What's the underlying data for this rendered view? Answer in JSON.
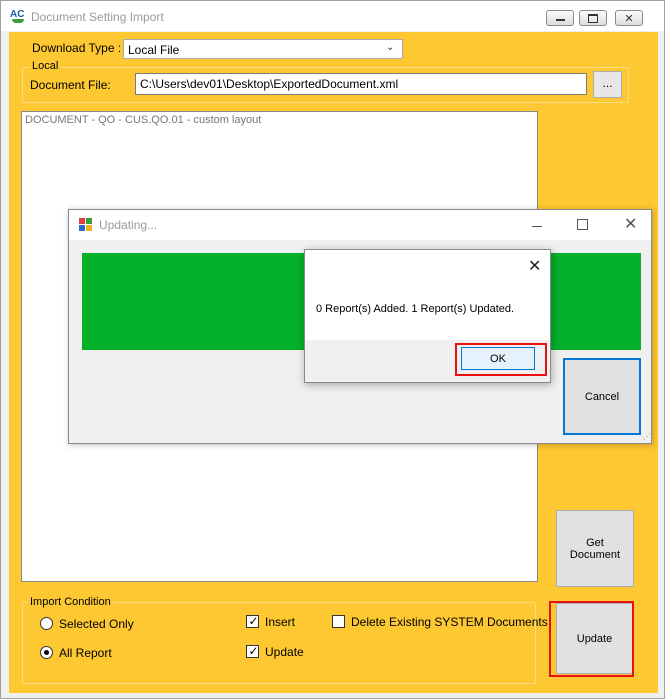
{
  "app": {
    "title": "Document Setting Import",
    "icon_text": "AC"
  },
  "download": {
    "label": "Download Type :",
    "value": "Local File"
  },
  "local": {
    "legend": "Local",
    "file_label": "Document File:",
    "file_value": "C:\\Users\\dev01\\Desktop\\ExportedDocument.xml",
    "browse_label": "..."
  },
  "doc_list": {
    "items": [
      "DOCUMENT - QO - CUS.QO.01 - custom layout"
    ]
  },
  "buttons": {
    "get_document": "Get Document",
    "update": "Update"
  },
  "import_condition": {
    "legend": "Import Condition",
    "radios": [
      {
        "label": "Selected Only",
        "checked": false
      },
      {
        "label": "All Report",
        "checked": true
      }
    ],
    "checkboxes": [
      {
        "label": "Insert",
        "checked": true
      },
      {
        "label": "Update",
        "checked": true
      },
      {
        "label": "Delete Existing SYSTEM Documents",
        "checked": false
      }
    ]
  },
  "updating_dialog": {
    "title": "Updating...",
    "progress": 1.0,
    "cancel_label": "Cancel"
  },
  "message_box": {
    "text": "0 Report(s) Added. 1 Report(s) Updated.",
    "ok_label": "OK"
  },
  "colors": {
    "form_background": "#fdc832",
    "progress_fill": "#05b02b",
    "highlight": "#e81010",
    "focus_border": "#0078d7"
  },
  "icons": {
    "close_glyph": "✕",
    "check_glyph": "✓",
    "chevron_glyph": "⌄"
  }
}
